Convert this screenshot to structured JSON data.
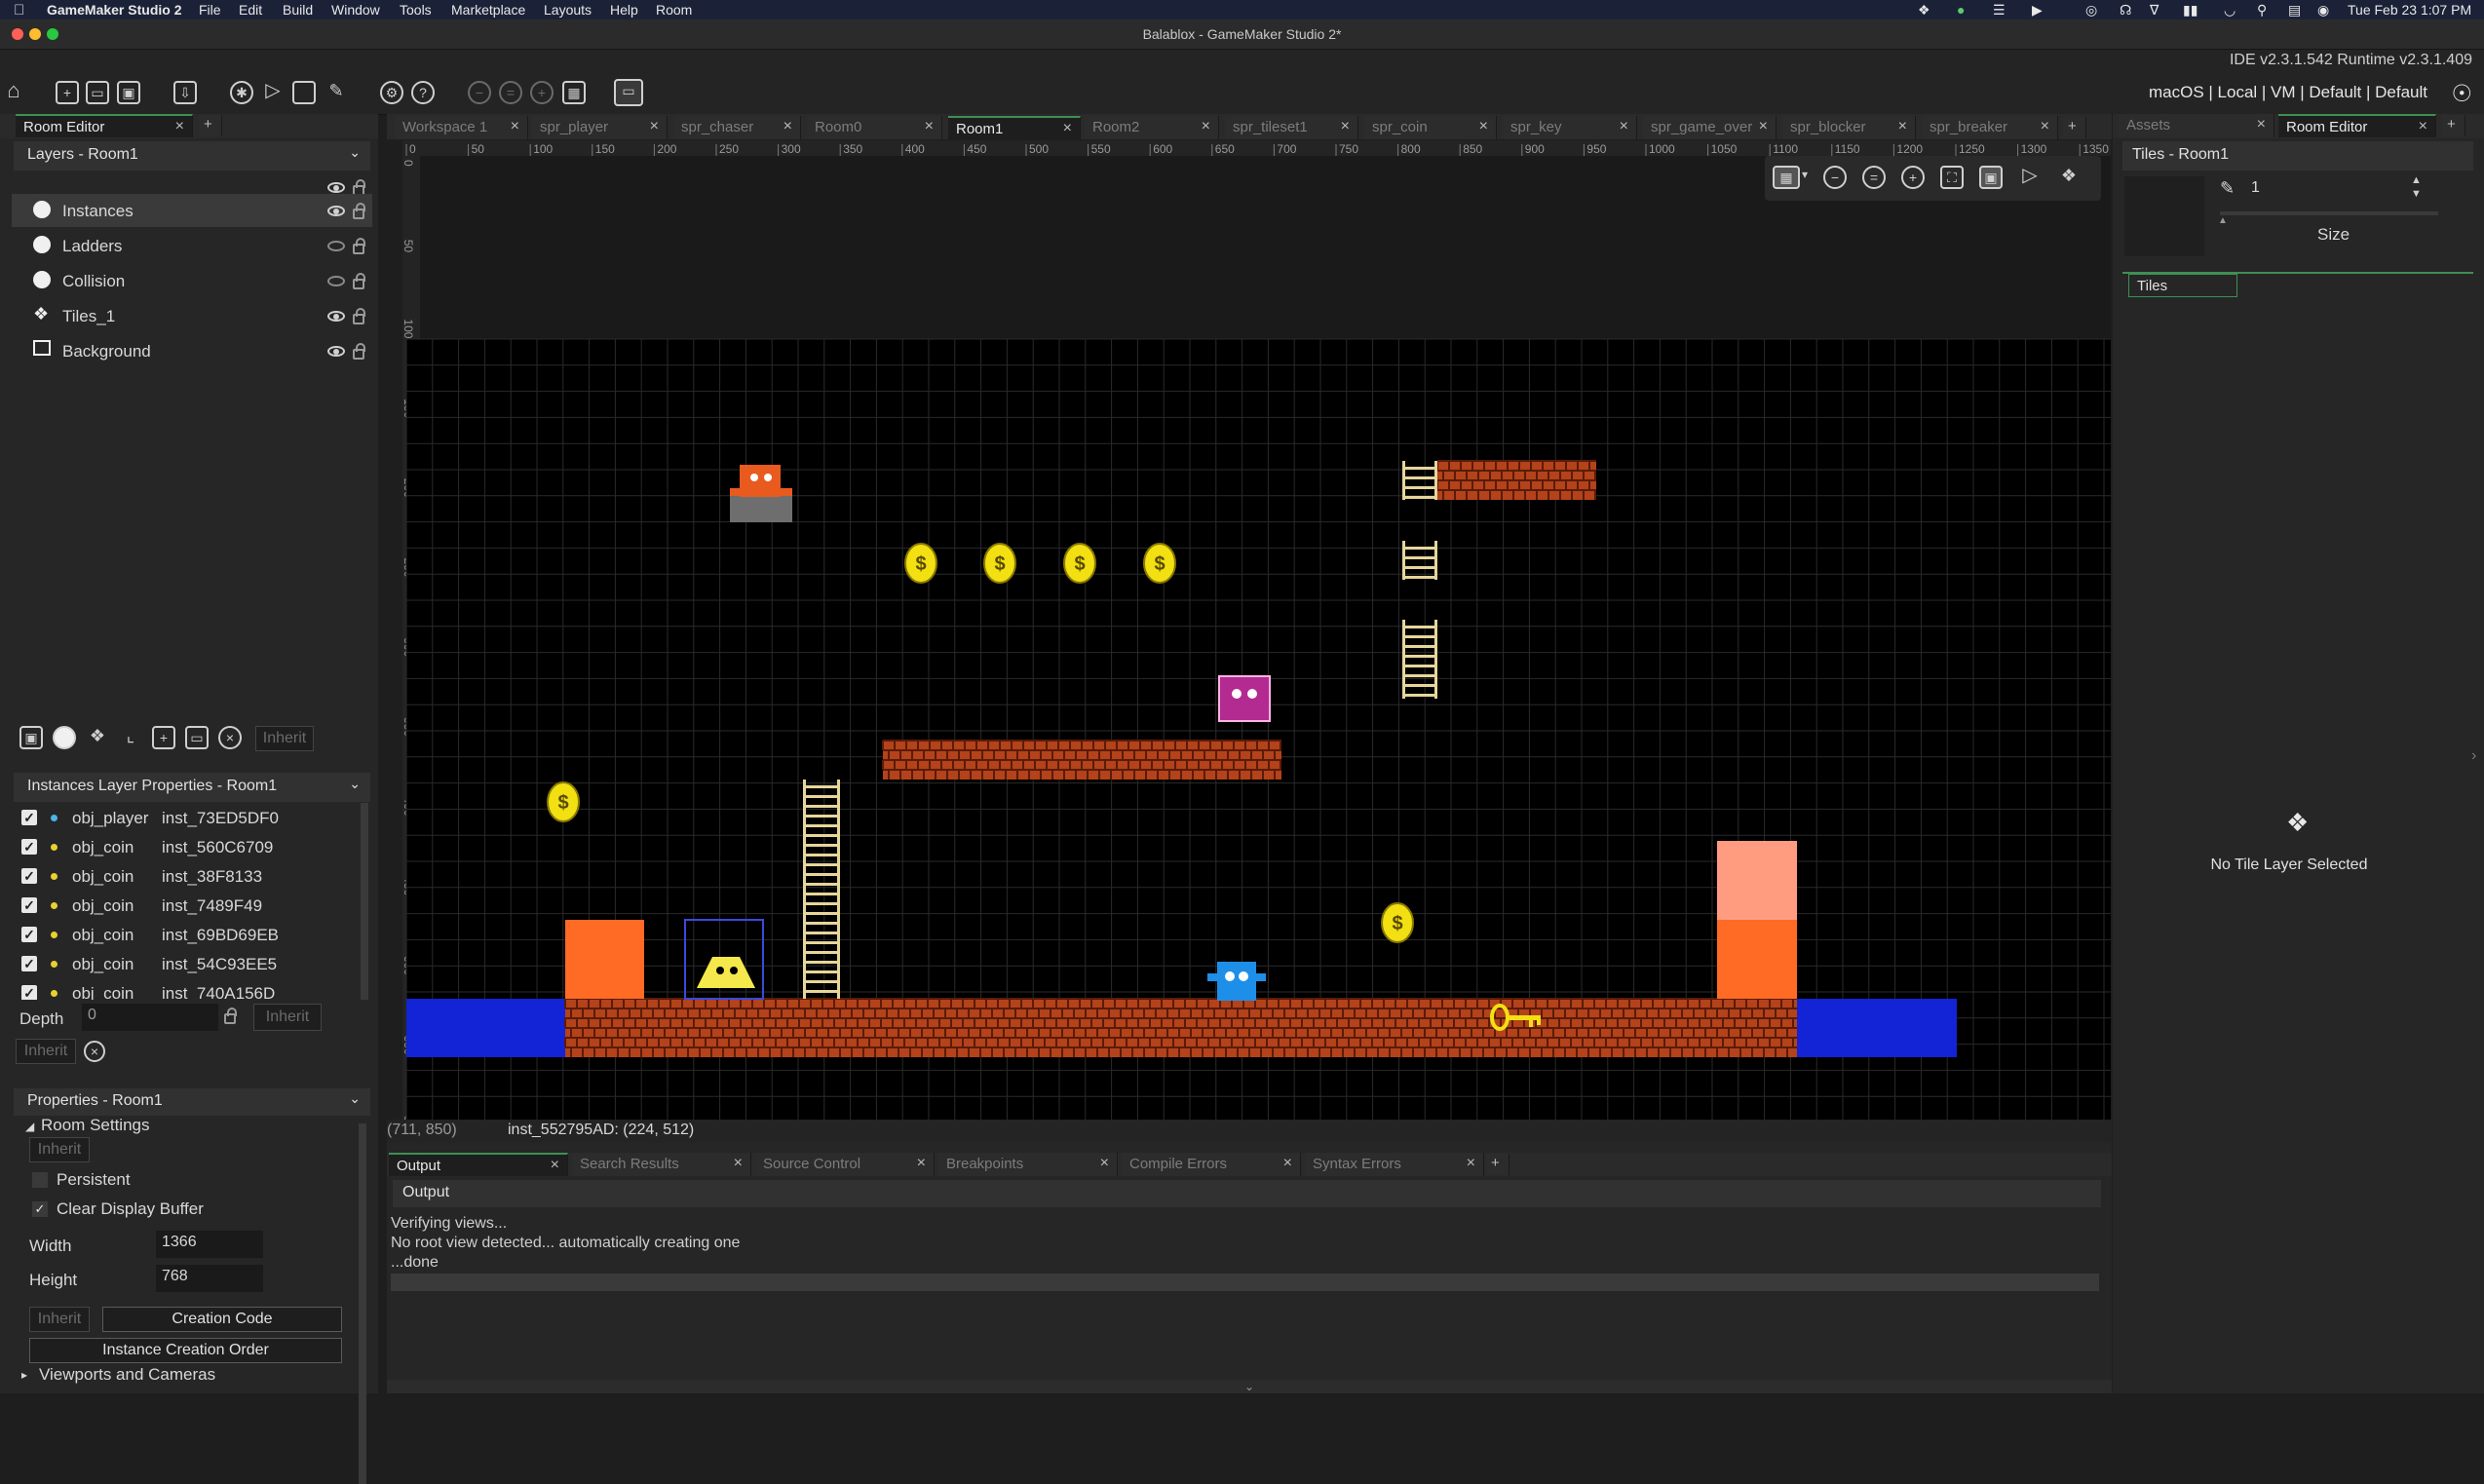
{
  "menubar": {
    "app": "GameMaker Studio 2",
    "items": [
      "File",
      "Edit",
      "Build",
      "Window",
      "Tools",
      "Marketplace",
      "Layouts",
      "Help",
      "Room"
    ],
    "clock": "Tue Feb 23  1:07 PM"
  },
  "window": {
    "title": "Balablox - GameMaker Studio 2*"
  },
  "toolbar": {
    "version": "IDE v2.3.1.542  Runtime v2.3.1.409",
    "targets": "macOS | Local | VM | Default | Default"
  },
  "left_tabs": {
    "room_editor": "Room Editor",
    "add": "+"
  },
  "layers": {
    "header": "Layers - Room1",
    "items": [
      {
        "name": "Instances",
        "visible": true,
        "selected": true
      },
      {
        "name": "Ladders",
        "visible": false
      },
      {
        "name": "Collision",
        "visible": false
      },
      {
        "name": "Tiles_1",
        "visible": true
      },
      {
        "name": "Background",
        "visible": true
      }
    ],
    "inherit_label": "Inherit"
  },
  "instances_panel": {
    "header": "Instances Layer Properties - Room1",
    "rows": [
      {
        "object": "obj_player",
        "id": "inst_73ED5DF0",
        "color": "#4fb3e8"
      },
      {
        "object": "obj_coin",
        "id": "inst_560C6709",
        "color": "#e8d130"
      },
      {
        "object": "obj_coin",
        "id": "inst_38F8133",
        "color": "#e8d130"
      },
      {
        "object": "obj_coin",
        "id": "inst_7489F49",
        "color": "#e8d130"
      },
      {
        "object": "obj_coin",
        "id": "inst_69BD69EB",
        "color": "#e8d130"
      },
      {
        "object": "obj_coin",
        "id": "inst_54C93EE5",
        "color": "#e8d130"
      },
      {
        "object": "obj_coin",
        "id": "inst_740A156D",
        "color": "#e8d130"
      }
    ],
    "depth_label": "Depth",
    "depth_value": "0",
    "inherit_label": "Inherit"
  },
  "properties": {
    "header": "Properties - Room1",
    "room_settings": "Room Settings",
    "inherit_label": "Inherit",
    "persistent_label": "Persistent",
    "clear_buffer_label": "Clear Display Buffer",
    "width_label": "Width",
    "width_value": "1366",
    "height_label": "Height",
    "height_value": "768",
    "creation_code": "Creation Code",
    "creation_order": "Instance Creation Order",
    "viewports": "Viewports and Cameras"
  },
  "editor_tabs": [
    {
      "label": "Workspace 1",
      "active": false
    },
    {
      "label": "spr_player",
      "active": false
    },
    {
      "label": "spr_chaser",
      "active": false
    },
    {
      "label": "Room0",
      "active": false
    },
    {
      "label": "Room1",
      "active": true
    },
    {
      "label": "Room2",
      "active": false
    },
    {
      "label": "spr_tileset1",
      "active": false
    },
    {
      "label": "spr_coin",
      "active": false
    },
    {
      "label": "spr_key",
      "active": false
    },
    {
      "label": "spr_game_over",
      "active": false
    },
    {
      "label": "spr_blocker",
      "active": false
    },
    {
      "label": "spr_breaker",
      "active": false
    }
  ],
  "ruler": {
    "top": [
      "0",
      "50",
      "100",
      "150",
      "200",
      "250",
      "300",
      "350",
      "400",
      "450",
      "500",
      "550",
      "600",
      "650",
      "700",
      "750",
      "800",
      "850",
      "900",
      "950",
      "1000",
      "1050",
      "1100",
      "1150",
      "1200",
      "1250",
      "1300",
      "1350"
    ],
    "left": [
      "0",
      "50",
      "100",
      "150",
      "200",
      "250",
      "300",
      "350",
      "400",
      "450",
      "500",
      "550",
      "600"
    ]
  },
  "status_bar": {
    "cursor": "(711, 850)",
    "instance": "inst_552795AD: (224, 512)"
  },
  "output_tabs": [
    {
      "label": "Output",
      "active": true
    },
    {
      "label": "Search Results",
      "active": false
    },
    {
      "label": "Source Control",
      "active": false
    },
    {
      "label": "Breakpoints",
      "active": false
    },
    {
      "label": "Compile Errors",
      "active": false
    },
    {
      "label": "Syntax Errors",
      "active": false
    }
  ],
  "output": {
    "header": "Output",
    "lines": [
      "Verifying views...",
      "No root view detected... automatically creating one",
      "...done"
    ]
  },
  "right_tabs": {
    "assets": "Assets",
    "room_editor": "Room Editor",
    "add": "+"
  },
  "tiles_panel": {
    "header": "Tiles - Room1",
    "brush_size": "1",
    "size_label": "Size",
    "tiles_tab": "Tiles",
    "empty_message": "No Tile Layer Selected"
  },
  "icons": {
    "home": "home-icon",
    "new": "new-file-icon",
    "open": "open-folder-icon",
    "save": "save-icon",
    "package": "package-icon",
    "debug": "debug-icon",
    "run": "run-icon",
    "stop": "stop-icon",
    "clean": "clean-icon",
    "settings": "gear-icon",
    "help": "help-icon",
    "zoom_out": "zoom-out-icon",
    "zoom_in": "zoom-in-icon",
    "target": "target-icon"
  },
  "colors": {
    "accent_green": "#3f8f53",
    "brick": "#b4421a",
    "water": "#1224d6",
    "block_orange": "#ff6a24",
    "block_pink": "#ff9c80",
    "ladder": "#e6d69a",
    "coin": "#f2e012",
    "player": "#1e8fe8",
    "chaser": "#b32a91",
    "breaker": "#e85a1e"
  }
}
